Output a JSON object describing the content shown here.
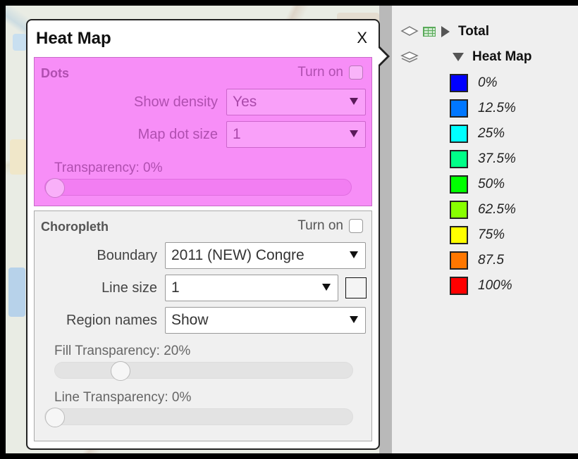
{
  "popup": {
    "title": "Heat Map",
    "close_label": "X",
    "dots": {
      "title": "Dots",
      "turn_on_label": "Turn on",
      "show_density_label": "Show density",
      "show_density_value": "Yes",
      "map_dot_size_label": "Map dot size",
      "map_dot_size_value": "1",
      "transparency_label": "Transparency:  0%",
      "transparency_value": 0
    },
    "choropleth": {
      "title": "Choropleth",
      "turn_on_label": "Turn on",
      "boundary_label": "Boundary",
      "boundary_value": "2011 (NEW) Congre",
      "line_size_label": "Line size",
      "line_size_value": "1",
      "region_names_label": "Region names",
      "region_names_value": "Show",
      "fill_transparency_label": "Fill Transparency:  20%",
      "fill_transparency_value": 20,
      "line_transparency_label": "Line Transparency:  0%",
      "line_transparency_value": 0
    }
  },
  "layers": {
    "total_label": "Total",
    "heatmap_label": "Heat Map"
  },
  "legend": {
    "items": [
      {
        "label": "0%",
        "color": "#0000ff"
      },
      {
        "label": "12.5%",
        "color": "#0077ff"
      },
      {
        "label": "25%",
        "color": "#00ffff"
      },
      {
        "label": "37.5%",
        "color": "#00ff88"
      },
      {
        "label": "50%",
        "color": "#00ff00"
      },
      {
        "label": "62.5%",
        "color": "#88ff00"
      },
      {
        "label": "75%",
        "color": "#ffff00"
      },
      {
        "label": "87.5",
        "color": "#ff7700"
      },
      {
        "label": "100%",
        "color": "#ff0000"
      }
    ]
  }
}
